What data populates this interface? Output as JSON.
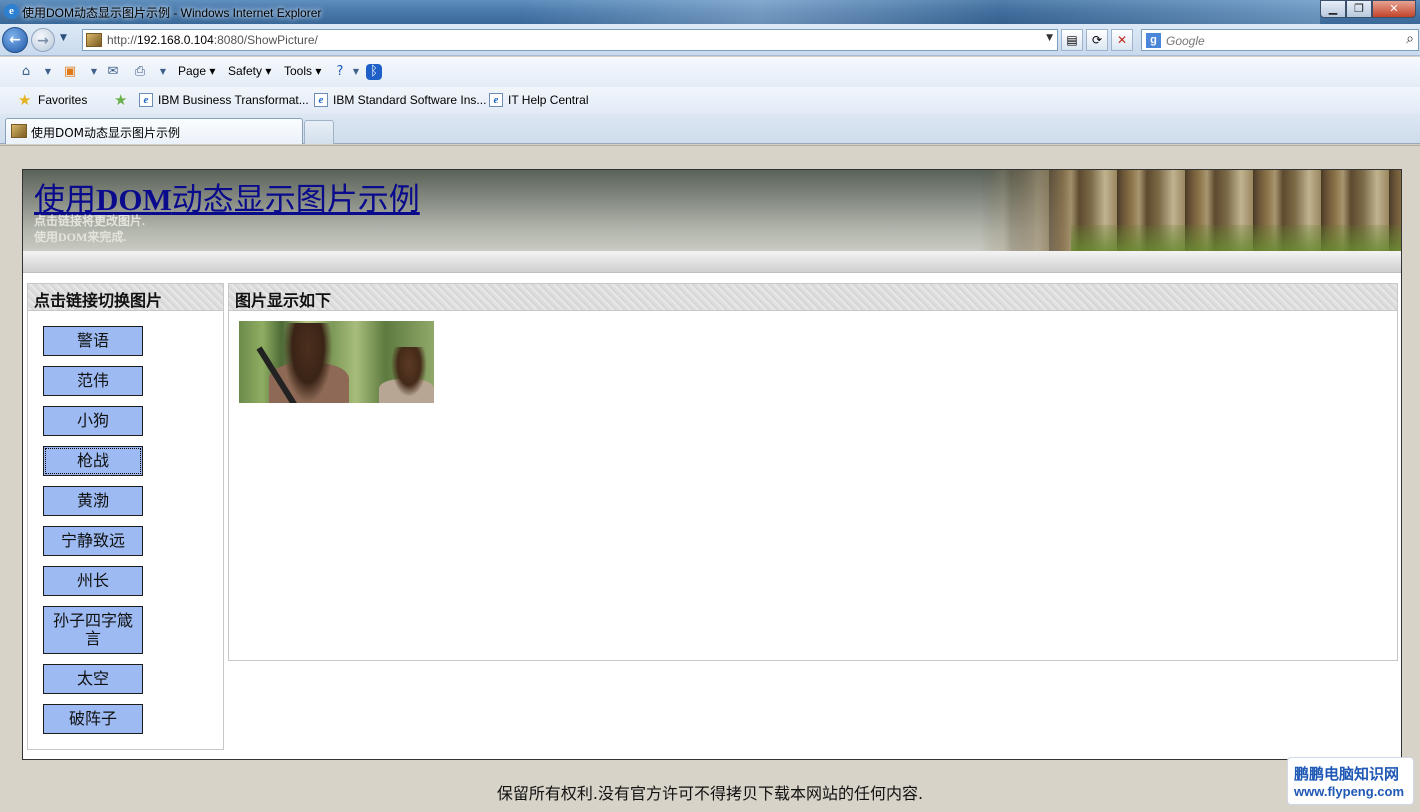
{
  "window": {
    "title": "使用DOM动态显示图片示例 - Windows Internet Explorer",
    "minimize": "▁",
    "maximize": "❐",
    "close": "✕"
  },
  "nav": {
    "address_host": "http://",
    "address_ip": "192.168.0.104",
    "address_rest": ":8080/ShowPicture/",
    "search_placeholder": "Google",
    "search_engine_letter": "g"
  },
  "toolbar": {
    "page_label": "Page",
    "safety_label": "Safety",
    "tools_label": "Tools"
  },
  "favorites": {
    "label": "Favorites",
    "items": [
      "IBM Business Transformat...",
      "IBM Standard Software Ins...",
      "IT Help Central"
    ]
  },
  "tabs": [
    {
      "label": "使用DOM动态显示图片示例"
    }
  ],
  "page": {
    "title_prefix": "使用",
    "title_bold": "DOM",
    "title_suffix": "动态显示图片示例",
    "subtitle1": "点击链接将更改图片.",
    "subtitle2": "使用DOM来完成.",
    "sidebar_heading": "点击链接切换图片",
    "main_heading": "图片显示如下",
    "links": [
      {
        "label": "警语"
      },
      {
        "label": "范伟"
      },
      {
        "label": "小狗"
      },
      {
        "label": "枪战"
      },
      {
        "label": "黄渤"
      },
      {
        "label": "宁静致远"
      },
      {
        "label": "州长"
      },
      {
        "label": "孙子四字箴言"
      },
      {
        "label": "太空"
      },
      {
        "label": "破阵子"
      }
    ],
    "footer": "保留所有权利.没有官方许可不得拷贝下载本网站的任何内容."
  },
  "watermark": {
    "line1": "鹏鹏电脑知识网",
    "line2": "www.flypeng.com"
  }
}
